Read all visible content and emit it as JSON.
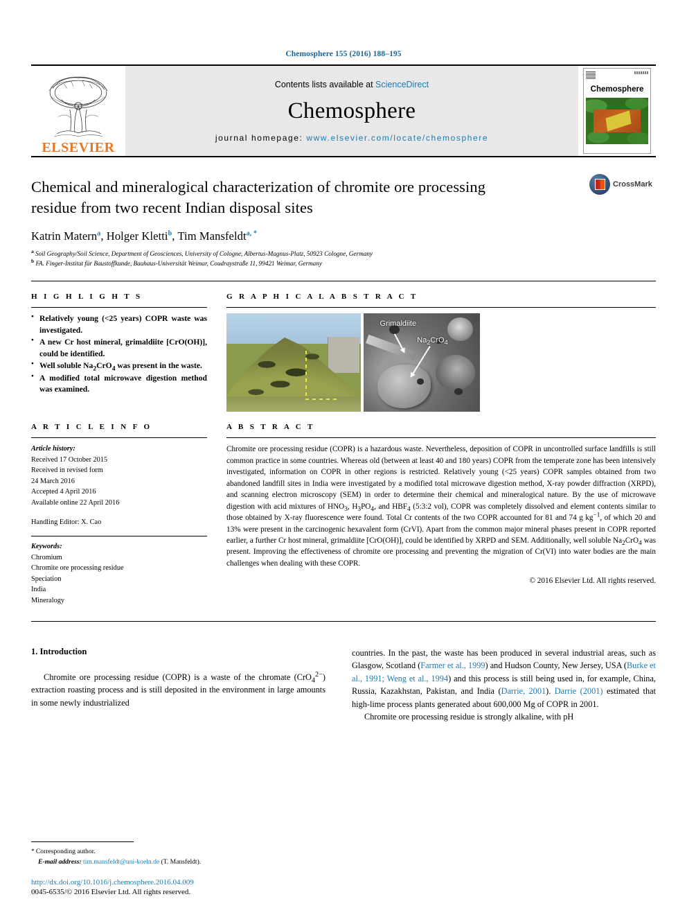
{
  "running_head": "Chemosphere 155 (2016) 188–195",
  "masthead": {
    "publisher": "ELSEVIER",
    "contents_prefix": "Contents lists available at ",
    "contents_link": "ScienceDirect",
    "journal_name": "Chemosphere",
    "homepage_prefix": "journal homepage: ",
    "homepage_url": "www.elsevier.com/locate/chemosphere",
    "cover_title": "Chemosphere"
  },
  "article": {
    "title": "Chemical and mineralogical characterization of chromite ore processing residue from two recent Indian disposal sites",
    "authors": [
      {
        "name": "Katrin Matern",
        "marker": "a"
      },
      {
        "name": "Holger Kletti",
        "marker": "b"
      },
      {
        "name": "Tim Mansfeldt",
        "marker": "a, *"
      }
    ],
    "affiliations": [
      {
        "marker": "a",
        "text": "Soil Geography/Soil Science, Department of Geosciences, University of Cologne, Albertus-Magnus-Platz, 50923 Cologne, Germany"
      },
      {
        "marker": "b",
        "text": "FA. Finger-Institut für Baustoffkunde, Bauhaus-Universität Weimar, Coudraystraße 11, 99421 Weimar, Germany"
      }
    ],
    "crossmark_label": "CrossMark"
  },
  "highlights": {
    "heading": "H I G H L I G H T S",
    "items": [
      "Relatively young (<25 years) COPR waste was investigated.",
      "A new Cr host mineral, grimaldiite [CrO(OH)], could be identified.",
      "Well soluble Na2CrO4 was present in the waste.",
      "A modified total microwave digestion method was examined."
    ]
  },
  "graphical_abstract": {
    "heading": "G R A P H I C A L   A B S T R A C T",
    "photo_caption": "",
    "sem_labels": [
      "Grimaldiite",
      "Na2CrO4"
    ]
  },
  "article_info": {
    "heading": "A R T I C L E   I N F O",
    "history_label": "Article history:",
    "history": [
      "Received 17 October 2015",
      "Received in revised form",
      "24 March 2016",
      "Accepted 4 April 2016",
      "Available online 22 April 2016"
    ],
    "handling_editor": "Handling Editor: X. Cao",
    "keywords_label": "Keywords:",
    "keywords": [
      "Chromium",
      "Chromite ore processing residue",
      "Speciation",
      "India",
      "Mineralogy"
    ]
  },
  "abstract": {
    "heading": "A B S T R A C T",
    "text": "Chromite ore processing residue (COPR) is a hazardous waste. Nevertheless, deposition of COPR in uncontrolled surface landfills is still common practice in some countries. Whereas old (between at least 40 and 180 years) COPR from the temperate zone has been intensively investigated, information on COPR in other regions is restricted. Relatively young (<25 years) COPR samples obtained from two abandoned landfill sites in India were investigated by a modified total microwave digestion method, X-ray powder diffraction (XRPD), and scanning electron microscopy (SEM) in order to determine their chemical and mineralogical nature. By the use of microwave digestion with acid mixtures of HNO3, H3PO4, and HBF4 (5:3:2 vol), COPR was completely dissolved and element contents similar to those obtained by X-ray fluorescence were found. Total Cr contents of the two COPR accounted for 81 and 74 g kg−1, of which 20 and 13% were present in the carcinogenic hexavalent form (CrVI). Apart from the common major mineral phases present in COPR reported earlier, a further Cr host mineral, grimaldiite [CrO(OH)], could be identified by XRPD and SEM. Additionally, well soluble Na2CrO4 was present. Improving the effectiveness of chromite ore processing and preventing the migration of Cr(VI) into water bodies are the main challenges when dealing with these COPR.",
    "copyright": "© 2016 Elsevier Ltd. All rights reserved."
  },
  "introduction": {
    "heading": "1. Introduction",
    "left_text": "Chromite ore processing residue (COPR) is a waste of the chromate (CrO42−) extraction roasting process and is still deposited in the environment in large amounts in some newly industrialized",
    "right_paragraph_1": "countries. In the past, the waste has been produced in several industrial areas, such as Glasgow, Scotland (Farmer et al., 1999) and Hudson County, New Jersey, USA (Burke et al., 1991; Weng et al., 1994) and this process is still being used in, for example, China, Russia, Kazakhstan, Pakistan, and India (Darrie, 2001). Darrie (2001) estimated that high-lime process plants generated about 600,000 Mg of COPR in 2001.",
    "right_paragraph_2": "Chromite ore processing residue is strongly alkaline, with pH",
    "citations": [
      "Farmer et al., 1999",
      "Burke et al., 1991; Weng et al., 1994",
      "Darrie, 2001",
      "Darrie (2001)"
    ]
  },
  "footer": {
    "corresponding_marker": "*",
    "corresponding_label": "Corresponding author.",
    "email_label": "E-mail address:",
    "email": "tim.mansfeldt@uni-koeln.de",
    "email_suffix": "(T. Mansfeldt).",
    "doi": "http://dx.doi.org/10.1016/j.chemosphere.2016.04.009",
    "issn_line": "0045-6535/© 2016 Elsevier Ltd. All rights reserved."
  },
  "colors": {
    "link": "#1a7ab5",
    "running_head": "#1a6496",
    "elsevier_orange": "#E87722",
    "masthead_bg": "#e8e8e8"
  }
}
